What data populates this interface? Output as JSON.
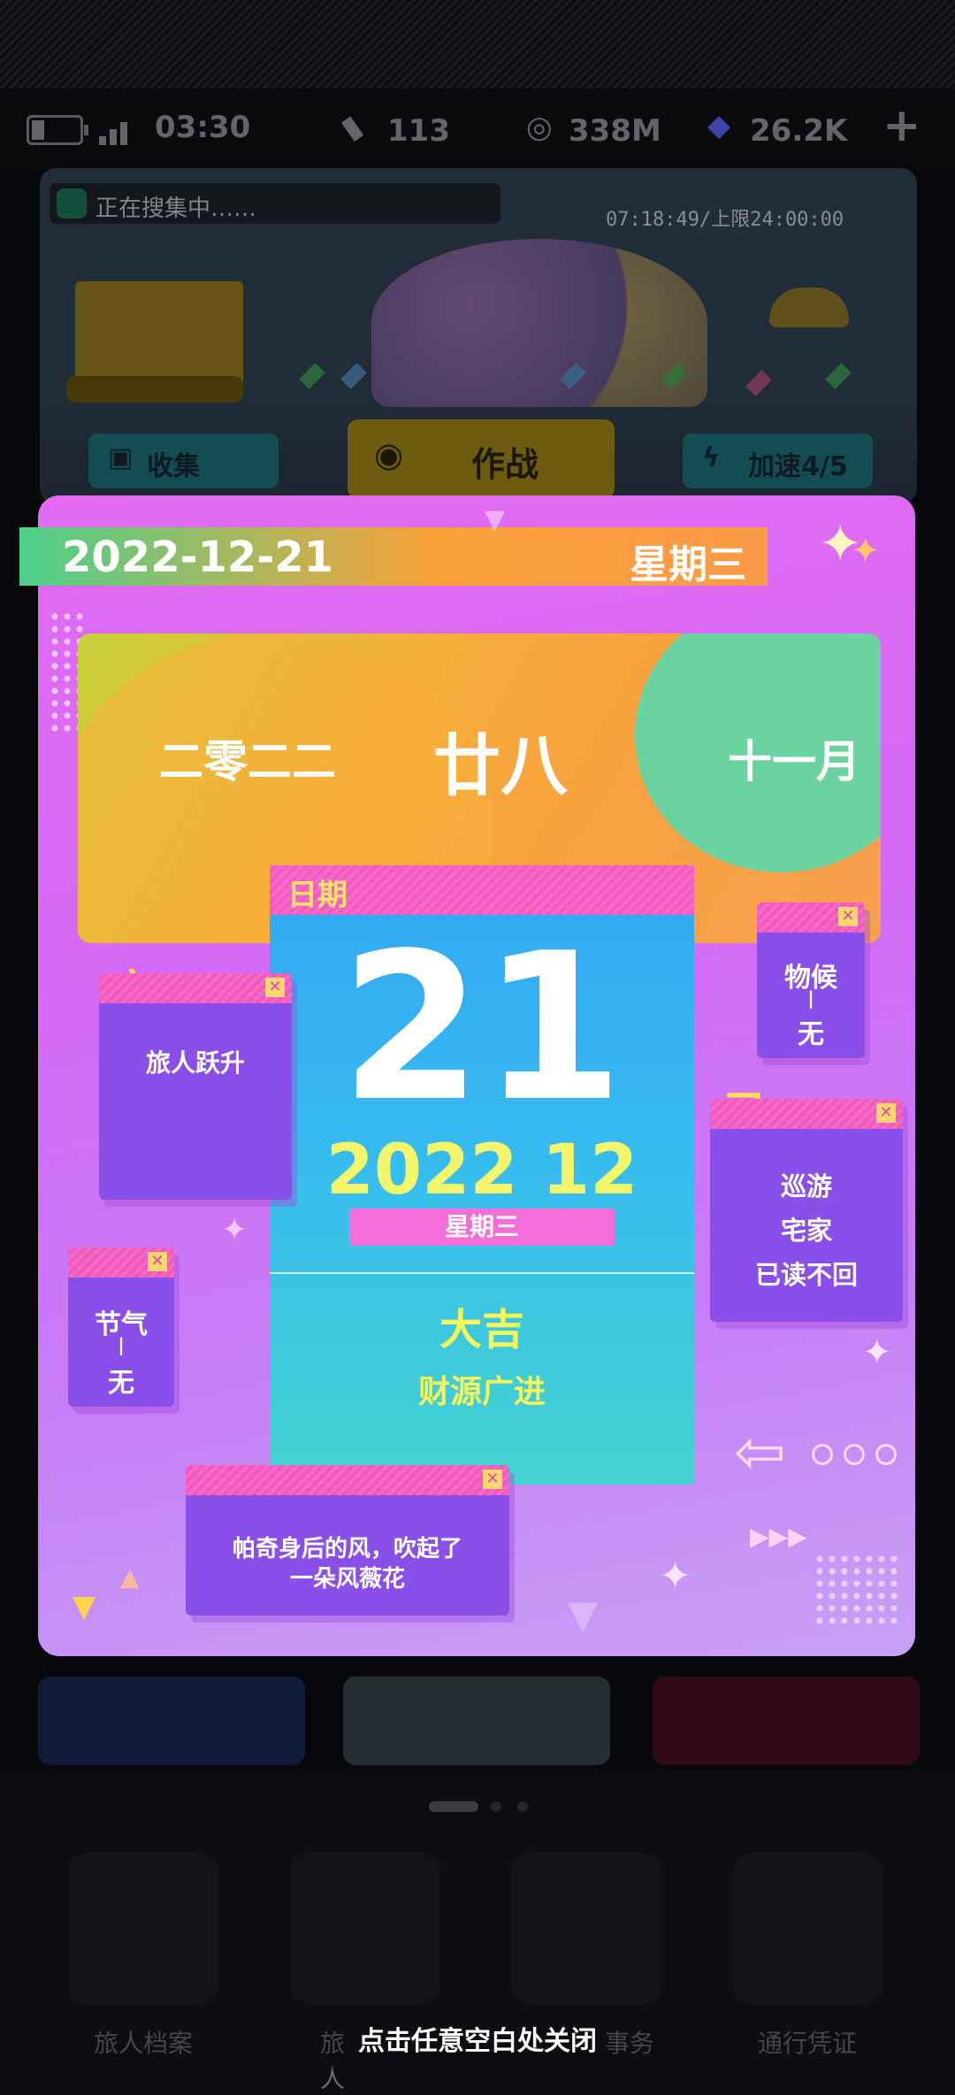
{
  "status": {
    "time": "03:30",
    "stamina": "113",
    "coins": "338M",
    "cubes": "26.2K",
    "add_icon": "plus-icon"
  },
  "game": {
    "search_text": "正在搜集中……",
    "timer_text": "07:18:49/上限24:00:00",
    "collect_label": "收集",
    "battle_label": "作战",
    "speed_label": "加速4/5"
  },
  "calendar": {
    "date": "2022-12-21",
    "weekday": "星期三",
    "lunar_year": "二零二二",
    "lunar_day": "廿八",
    "lunar_month": "十一月",
    "date_tab": "日期",
    "day": "21",
    "year_month": "2022 12",
    "weekday_pill": "星期三",
    "fortune": "大吉",
    "fortune_detail": "财源广进",
    "yi_label": "宜",
    "yi_items": [
      "旅人跃升"
    ],
    "ji_label": "忌",
    "ji_items": [
      "巡游",
      "宅家",
      "已读不回"
    ],
    "phenology_label": "物候",
    "phenology_value": "无",
    "solar_term_label": "节气",
    "solar_term_value": "无",
    "quote_line1": "帕奇身后的风，吹起了",
    "quote_line2": "一朵风薇花",
    "close_symbol": "✕"
  },
  "dock": {
    "items": [
      "旅人档案",
      "旅人",
      "事务",
      "通行凭证"
    ],
    "close_hint": "点击任意空白处关闭"
  },
  "colors": {
    "modal_bg": "#d46af5",
    "date_card": "#34a7f2",
    "window_purple": "#8a4fe8",
    "accent_yellow": "#f6f55a"
  }
}
